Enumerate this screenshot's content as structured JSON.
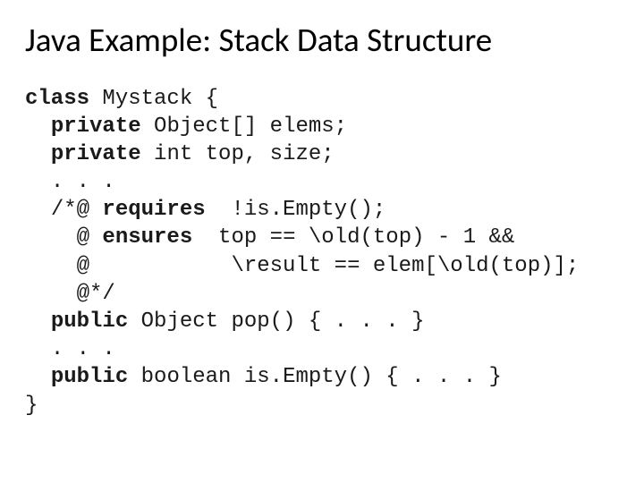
{
  "title": "Java Example: Stack Data Structure",
  "code": {
    "l0_kw": "class",
    "l0_rest": " Mystack {",
    "l1_kw": "private",
    "l1_rest": " Object[] elems;",
    "l2_kw": "private",
    "l2_rest": " int top, size;",
    "l3": ". . .",
    "l4_a": "/*@ ",
    "l4_kw": "requires",
    "l4_b": "  !is.Empty();",
    "l5_a": "  @ ",
    "l5_kw": "ensures",
    "l5_b": "  top == \\old(top) - 1 &&",
    "l6": "  @           \\result == elem[\\old(top)];",
    "l7": "  @*/",
    "l8_kw": "public",
    "l8_rest": " Object pop() { . . . }",
    "l9": ". . .",
    "l10_kw": "public",
    "l10_rest": " boolean is.Empty() { . . . }",
    "l11": "}"
  }
}
